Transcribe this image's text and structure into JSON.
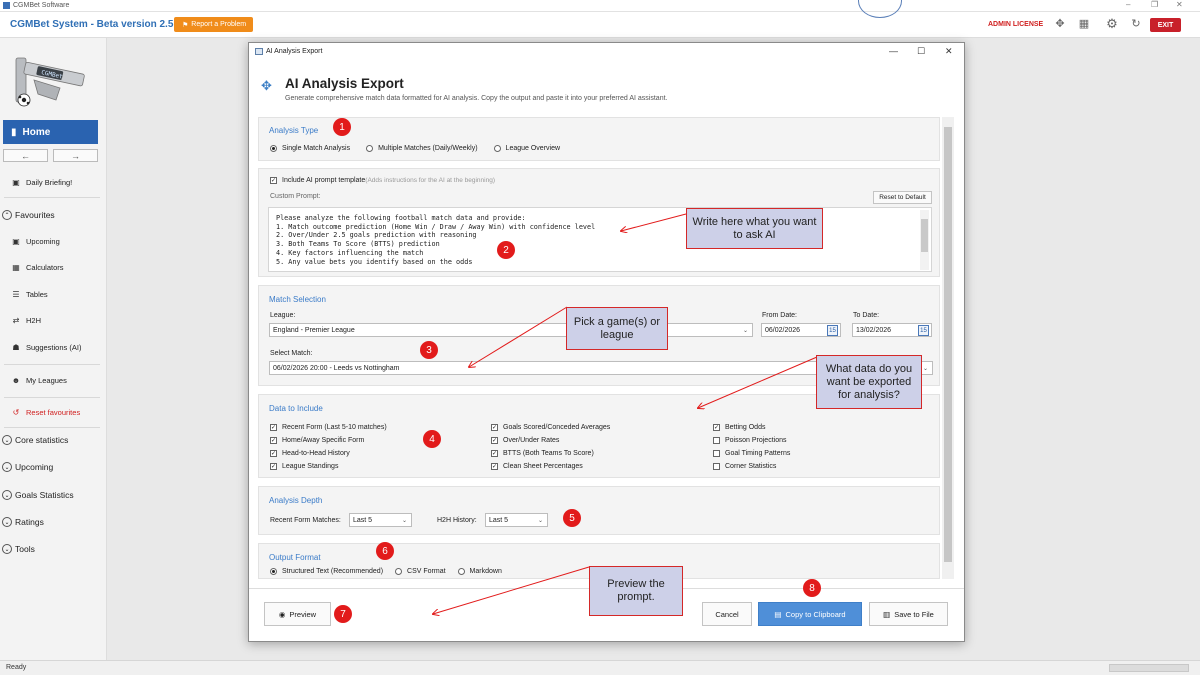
{
  "os": {
    "title": "CGMBet Software"
  },
  "app": {
    "name": "CGMBet System - Beta version 2.5.1",
    "report_label": "Report a Problem",
    "license_label": "ADMIN LICENSE",
    "exit_label": "EXIT"
  },
  "sidebar": {
    "logo_text": "CGMBet",
    "home_label": "Home",
    "daily_briefing": "Daily Briefing!",
    "favourites_label": "Favourites",
    "items": [
      "Upcoming",
      "Calculators",
      "Tables",
      "H2H",
      "Suggestions (AI)"
    ],
    "my_leagues": "My Leagues",
    "reset_favourites": "Reset favourites",
    "sections": [
      "Core statistics",
      "Upcoming",
      "Goals Statistics",
      "Ratings",
      "Tools"
    ]
  },
  "status": {
    "text": "Ready"
  },
  "dialog": {
    "window_title": "AI Analysis Export",
    "title": "AI Analysis Export",
    "subtitle": "Generate comprehensive match data formatted for AI analysis. Copy the output and paste it into your preferred AI assistant.",
    "analysis_type": {
      "title": "Analysis Type",
      "options": [
        "Single Match Analysis",
        "Multiple Matches (Daily/Weekly)",
        "League Overview"
      ],
      "selected": "Single Match Analysis"
    },
    "prompt": {
      "include_label": "Include AI prompt template",
      "include_hint": "(Adds instructions for the AI at the beginning)",
      "include_checked": true,
      "custom_label": "Custom Prompt:",
      "reset_label": "Reset to Default",
      "lines": [
        "Please analyze the following football match data and provide:",
        "1. Match outcome prediction (Home Win / Draw / Away Win) with confidence level",
        "2. Over/Under 2.5 goals prediction with reasoning",
        "3. Both Teams To Score (BTTS) prediction",
        "4. Key factors influencing the match",
        "5. Any value bets you identify based on the odds"
      ]
    },
    "match_selection": {
      "title": "Match Selection",
      "league_label": "League:",
      "league_value": "England - Premier League",
      "from_label": "From Date:",
      "from_value": "06/02/2026",
      "to_label": "To Date:",
      "to_value": "13/02/2026",
      "match_label": "Select Match:",
      "match_value": "06/02/2026 20:00 - Leeds vs Nottingham"
    },
    "data_include": {
      "title": "Data to Include",
      "col1": [
        {
          "label": "Recent Form (Last 5-10 matches)",
          "checked": true
        },
        {
          "label": "Home/Away Specific Form",
          "checked": true
        },
        {
          "label": "Head-to-Head History",
          "checked": true
        },
        {
          "label": "League Standings",
          "checked": true
        }
      ],
      "col2": [
        {
          "label": "Goals Scored/Conceded Averages",
          "checked": true
        },
        {
          "label": "Over/Under Rates",
          "checked": true
        },
        {
          "label": "BTTS (Both Teams To Score)",
          "checked": true
        },
        {
          "label": "Clean Sheet Percentages",
          "checked": true
        }
      ],
      "col3": [
        {
          "label": "Betting Odds",
          "checked": true
        },
        {
          "label": "Poisson Projections",
          "checked": false
        },
        {
          "label": "Goal Timing Patterns",
          "checked": false
        },
        {
          "label": "Corner Statistics",
          "checked": false
        }
      ]
    },
    "depth": {
      "title": "Analysis Depth",
      "recent_label": "Recent Form Matches:",
      "recent_value": "Last 5",
      "h2h_label": "H2H History:",
      "h2h_value": "Last 5"
    },
    "output": {
      "title": "Output Format",
      "options": [
        "Structured Text (Recommended)",
        "CSV Format",
        "Markdown"
      ],
      "selected": "Structured Text (Recommended)"
    },
    "buttons": {
      "preview": "Preview",
      "cancel": "Cancel",
      "copy": "Copy to Clipboard",
      "save": "Save to File"
    }
  },
  "annotations": {
    "badges": [
      "1",
      "2",
      "3",
      "4",
      "5",
      "6",
      "7",
      "8"
    ],
    "notes": {
      "ask": "Write here what you want to ask AI",
      "pick": "Pick a game(s) or league",
      "data": "What data do you want be exported for analysis?",
      "preview": "Preview the prompt."
    },
    "color": "#e21b1b"
  },
  "colors": {
    "accent": "#2a63b0",
    "section_title": "#3a7bc8",
    "exit": "#c8202a",
    "report": "#f08c1a",
    "copy_button": "#4f8fd8"
  }
}
